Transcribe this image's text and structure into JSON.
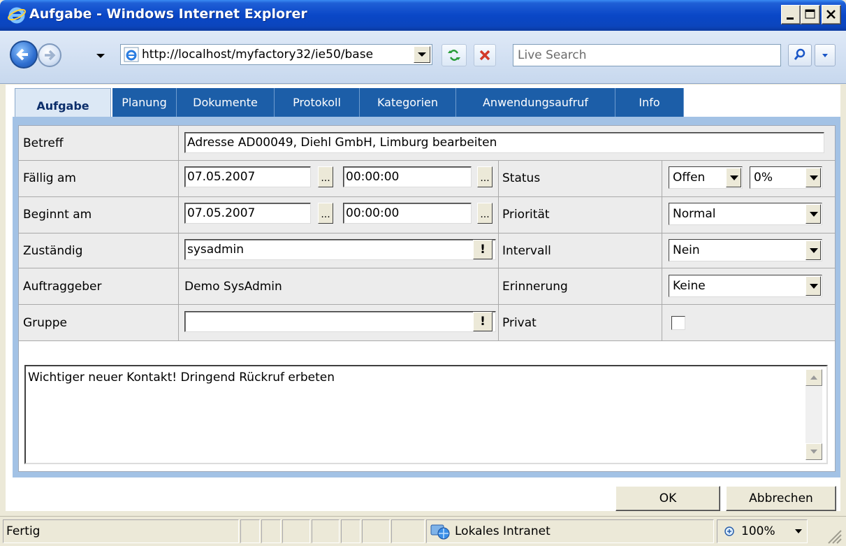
{
  "window": {
    "title": "Aufgabe - Windows Internet Explorer"
  },
  "nav": {
    "address": "http://localhost/myfactory32/ie50/base",
    "search_placeholder": "Live Search"
  },
  "tabs": [
    "Aufgabe",
    "Planung",
    "Dokumente",
    "Protokoll",
    "Kategorien",
    "Anwendungsaufruf",
    "Info"
  ],
  "form": {
    "betreff_label": "Betreff",
    "betreff_value": "Adresse AD00049, Diehl GmbH, Limburg bearbeiten",
    "faellig_label": "Fällig am",
    "faellig_date": "07.05.2007",
    "faellig_time": "00:00:00",
    "status_label": "Status",
    "status_value": "Offen",
    "status_percent": "0%",
    "beginnt_label": "Beginnt am",
    "beginnt_date": "07.05.2007",
    "beginnt_time": "00:00:00",
    "prioritaet_label": "Priorität",
    "prioritaet_value": "Normal",
    "zustaendig_label": "Zuständig",
    "zustaendig_value": "sysadmin",
    "intervall_label": "Intervall",
    "intervall_value": "Nein",
    "auftraggeber_label": "Auftraggeber",
    "auftraggeber_value": "Demo SysAdmin",
    "erinnerung_label": "Erinnerung",
    "erinnerung_value": "Keine",
    "gruppe_label": "Gruppe",
    "gruppe_value": "",
    "privat_label": "Privat",
    "privat_checked": false,
    "dots": "...",
    "bang": "!",
    "notes": "Wichtiger neuer Kontakt! Dringend Rückruf erbeten"
  },
  "buttons": {
    "ok": "OK",
    "cancel": "Abbrechen"
  },
  "statusbar": {
    "status": "Fertig",
    "zone": "Lokales Intranet",
    "zoom": "100%"
  },
  "colors": {
    "tab_blue": "#1c5ea8",
    "panel_blue": "#a3c2e5",
    "titlebar": "#0a47c7"
  }
}
